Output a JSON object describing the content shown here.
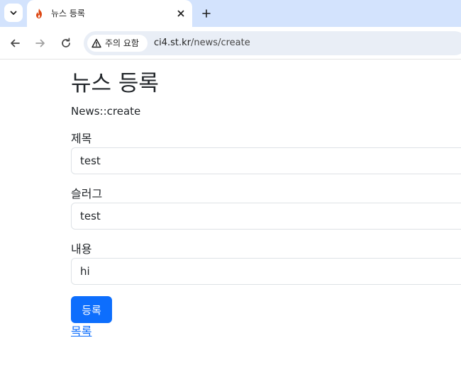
{
  "browser": {
    "tab": {
      "title": "뉴스 등록",
      "favicon": "codeigniter-flame-icon"
    },
    "security_chip": "주의 요함",
    "url": {
      "host": "ci4.st.kr",
      "path": "/news/create"
    }
  },
  "page": {
    "title": "뉴스 등록",
    "subtitle": "News::create",
    "fields": [
      {
        "label": "제목",
        "value": "test"
      },
      {
        "label": "슬러그",
        "value": "test"
      },
      {
        "label": "내용",
        "value": "hi"
      }
    ],
    "submit_label": "등록",
    "list_link": "목록"
  },
  "colors": {
    "tabstrip_bg": "#d3e3fd",
    "omnibox_bg": "#e9eef6",
    "primary": "#0d6efd",
    "text": "#212529",
    "input_border": "#dee2e6"
  }
}
